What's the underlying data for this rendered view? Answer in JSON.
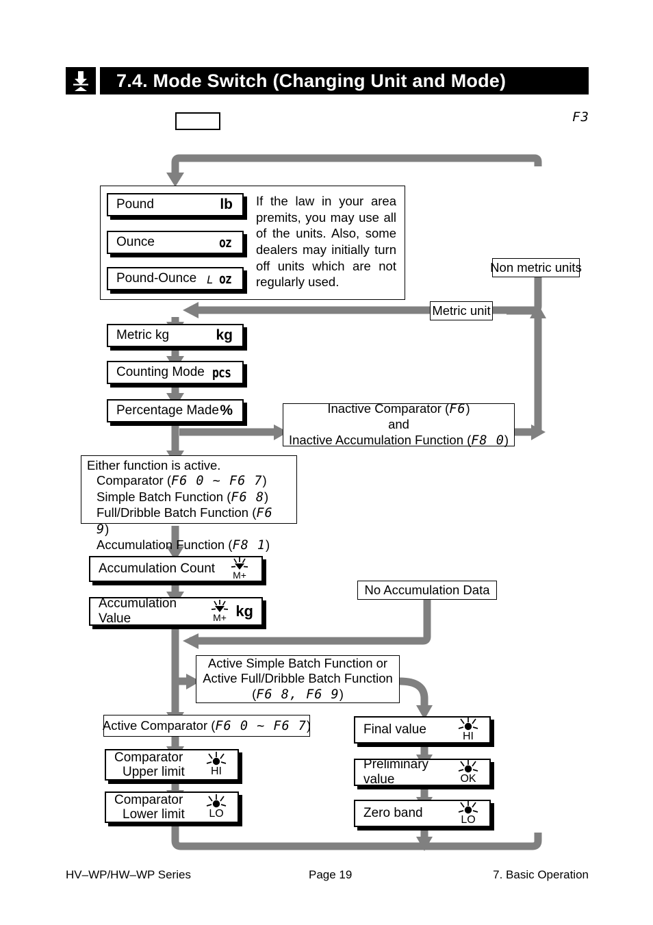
{
  "header": {
    "icon": "mode-switch-icon",
    "title": "7.4.  Mode Switch (Changing Unit and Mode)",
    "key_label": "",
    "function_code": "F3"
  },
  "flow": {
    "unit_box": {
      "units": [
        {
          "name": "Pound",
          "symbol": "lb",
          "symbol_style": "bold"
        },
        {
          "name": "Ounce",
          "symbol": "oz",
          "symbol_style": "lcd"
        },
        {
          "name": "Pound-Ounce",
          "symbol_prefix": "L",
          "symbol": "oz",
          "symbol_style": "lcd"
        }
      ],
      "note_lines": [
        "If the law in your area",
        "premits, you may use all",
        "of the units. Also, some",
        "dealers may initially turn",
        "off units which are not",
        "regularly used."
      ]
    },
    "metric_kg": {
      "name": "Metric kg",
      "symbol": "kg"
    },
    "counting_mode": {
      "name": "Counting Mode",
      "symbol": "pcs"
    },
    "percentage_mode": {
      "name": "Percentage Made",
      "symbol": "%"
    },
    "inactive_box": {
      "line1_pre": "Inactive Comparator (",
      "line1_code": "F6",
      "line1_post": ")",
      "line2": "and",
      "line3_pre": "Inactive Accumulation Function (",
      "line3_code": "F8  0",
      "line3_post": ")"
    },
    "active_list": {
      "title": "Either function is active.",
      "items": [
        {
          "label": "Comparator (",
          "code": "F6  0 ~ F6  7",
          "tail": ")"
        },
        {
          "label": "Simple Batch Function (",
          "code": "F6  8",
          "tail": ")"
        },
        {
          "label": "Full/Dribble Batch Function (",
          "code": "F6  9",
          "tail": ")"
        },
        {
          "label": "Accumulation Function (",
          "code": "F8  1",
          "tail": ")"
        }
      ]
    },
    "accumulation_count": {
      "name": "Accumulation Count",
      "indicator": "M+"
    },
    "accumulation_value": {
      "name": "Accumulation Value",
      "indicator": "M+",
      "unit": "kg"
    },
    "no_accumulation_data": "No Accumulation Data",
    "batch_box": {
      "line1": "Active Simple Batch Function  or",
      "line2": "Active Full/Dribble Batch Function",
      "line3_pre": "(",
      "line3_code": "F6  8, F6  9",
      "line3_post": ")"
    },
    "active_comparator": {
      "label_pre": "Active Comparator (",
      "code": "F6  0 ~ F6  7",
      "label_post": ")"
    },
    "comparator_upper": {
      "line1": "Comparator",
      "line2": "Upper limit",
      "indicator": "HI"
    },
    "comparator_lower": {
      "line1": "Comparator",
      "line2": "Lower limit",
      "indicator": "LO"
    },
    "final_value": {
      "name": "Final value",
      "indicator": "HI"
    },
    "preliminary_value": {
      "name": "Preliminary value",
      "indicator": "OK"
    },
    "zero_band": {
      "name": "Zero band",
      "indicator": "LO"
    },
    "path_labels": {
      "non_metric": "Non metric units",
      "metric": "Metric unit"
    }
  },
  "footer": {
    "left": "HV–WP/HW–WP Series",
    "center": "Page 19",
    "right": "7. Basic Operation"
  },
  "colors": {
    "arrow": "#808080",
    "ink": "#000000",
    "paper": "#ffffff"
  }
}
